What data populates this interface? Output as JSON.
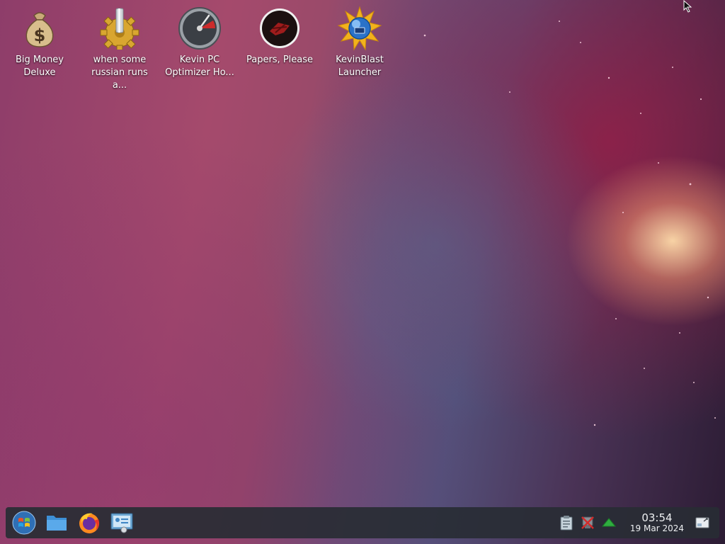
{
  "desktop_icons": [
    {
      "label": "Big Money\nDeluxe",
      "icon": "money-bag-icon"
    },
    {
      "label": "when some\nrussian runs a...",
      "icon": "gear-icon"
    },
    {
      "label": "Kevin PC\nOptimizer Ho...",
      "icon": "speedometer-icon"
    },
    {
      "label": "Papers, Please",
      "icon": "papers-please-icon"
    },
    {
      "label": "KevinBlast\nLauncher",
      "icon": "kevinblast-icon"
    }
  ],
  "taskbar": {
    "pinned": [
      "start-orb-icon",
      "file-manager-icon",
      "firefox-icon",
      "control-panel-icon"
    ],
    "tray": [
      "clipboard-icon",
      "network-disabled-icon",
      "updates-arrow-icon"
    ],
    "clock": {
      "time": "03:54",
      "date": "19 Mar 2024"
    },
    "show_desktop_icon": "show-desktop-icon"
  }
}
